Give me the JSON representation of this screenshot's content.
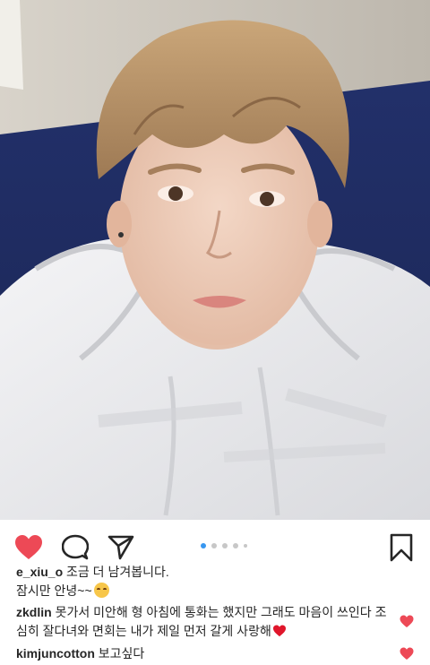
{
  "post": {
    "image_alt": "selfie photo",
    "carousel": {
      "total_dots": 5,
      "active_index": 0
    }
  },
  "actions": {
    "like_icon": "heart-filled-icon",
    "comment_icon": "comment-bubble-icon",
    "share_icon": "paper-plane-icon",
    "save_icon": "bookmark-icon",
    "like_color": "#ed4956"
  },
  "caption": {
    "username": "e_xiu_o",
    "line1": "조금 더 남겨봅니다.",
    "line2": "잠시만 안녕~~",
    "emoji": "smiling-blush-emoji"
  },
  "comments": [
    {
      "username": "zkdlin",
      "text": "못가서 미안해 형 아침에 통화는 했지만 그래도 마음이 쓰인다 조심히 잘다녀와 면회는 내가 제일 먼저 갈게 사랑해",
      "emoji": "red-heart-emoji",
      "liked_icon": "heart-filled-icon"
    },
    {
      "username": "kimjuncotton",
      "text": "보고싶다",
      "liked_icon": "heart-filled-icon"
    }
  ]
}
